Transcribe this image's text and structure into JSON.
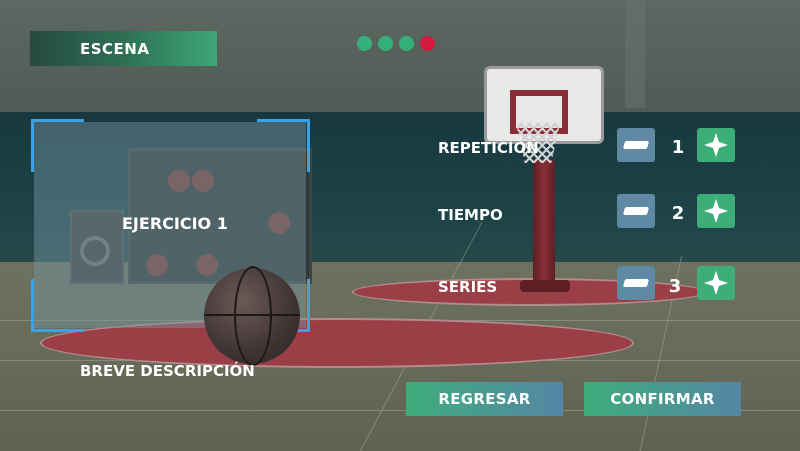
{
  "scene_tag": {
    "label": "ESCENA"
  },
  "progress_dots": [
    {
      "state": "complete",
      "color": "#36b07a"
    },
    {
      "state": "complete",
      "color": "#36b07a"
    },
    {
      "state": "complete",
      "color": "#36b07a"
    },
    {
      "state": "current",
      "color": "#d41a3f"
    }
  ],
  "exercise_panel": {
    "title": "EJERCICIO 1",
    "description_label": "BREVE DESCRIPCIÓN"
  },
  "settings": [
    {
      "label": "REPETICIÓN",
      "value": "1",
      "minus_icon": "minus-icon",
      "plus_icon": "plus-icon"
    },
    {
      "label": "TIEMPO",
      "value": "2",
      "minus_icon": "minus-icon",
      "plus_icon": "plus-icon"
    },
    {
      "label": "SERIES",
      "value": "3",
      "minus_icon": "minus-icon",
      "plus_icon": "plus-icon"
    }
  ],
  "actions": {
    "back_label": "REGRESAR",
    "confirm_label": "CONFIRMAR"
  },
  "colors": {
    "accent_green": "#3dae78",
    "accent_blue": "#5f89a5",
    "frame_blue": "#3aa3e6",
    "alert_red": "#d41a3f"
  }
}
